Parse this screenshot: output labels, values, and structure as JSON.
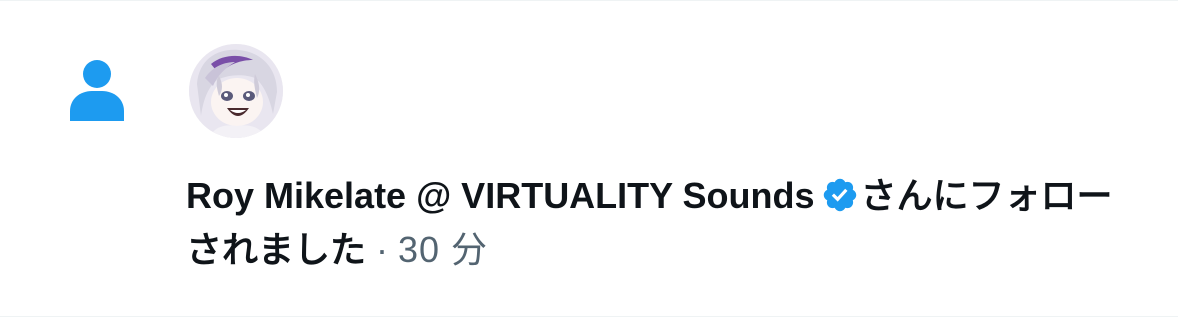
{
  "notification": {
    "type_icon": "person-icon",
    "type_icon_color": "#1d9bf0",
    "user_name": "Roy Mikelate @ VIRTUALITY Sounds",
    "verified_icon": "verified-badge-icon",
    "verified_color": "#1d9bf0",
    "message": "さんにフォローされました",
    "separator": " · ",
    "time": "30 分"
  },
  "colors": {
    "text_primary": "#0f1419",
    "text_secondary": "#536471",
    "divider": "#eff3f4"
  }
}
